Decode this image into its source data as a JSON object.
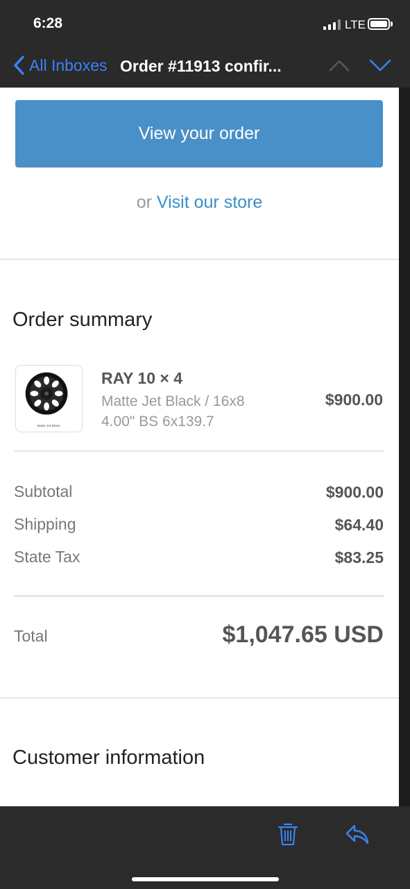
{
  "status_bar": {
    "time": "6:28",
    "network": "LTE"
  },
  "nav": {
    "back_label": "All Inboxes",
    "title": "Order #11913 confir..."
  },
  "email": {
    "view_order_label": "View your order",
    "or_text": "or",
    "visit_store_label": "Visit our store",
    "order_summary_heading": "Order summary",
    "product": {
      "name": "RAY 10 × 4",
      "variant": "Matte Jet Black / 16x8",
      "bs": "4.00\" BS 6x139.7",
      "price": "$900.00",
      "thumb_caption": "Matte Jet Black"
    },
    "costs": [
      {
        "label": "Subtotal",
        "value": "$900.00"
      },
      {
        "label": "Shipping",
        "value": "$64.40"
      },
      {
        "label": "State Tax",
        "value": "$83.25"
      }
    ],
    "total_label": "Total",
    "total_value": "$1,047.65 USD",
    "customer_info_heading": "Customer information"
  },
  "toolbar": {
    "icons": [
      "trash-icon",
      "reply-icon"
    ]
  },
  "colors": {
    "accent": "#3a82f7",
    "button": "#4a90c8",
    "link": "#3a8fc6"
  }
}
